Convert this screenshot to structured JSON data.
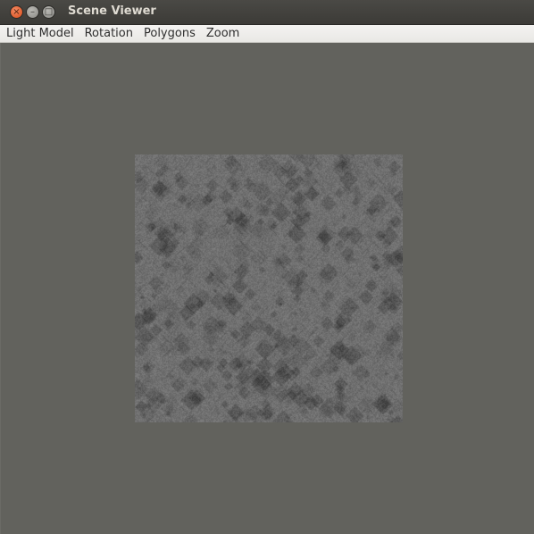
{
  "window": {
    "title": "Scene Viewer"
  },
  "titlebar_buttons": [
    {
      "name": "close-icon",
      "glyph": "×"
    },
    {
      "name": "minimize-icon",
      "glyph": "–"
    },
    {
      "name": "maximize-icon",
      "glyph": "□"
    }
  ],
  "menu": {
    "items": [
      {
        "label": "Light Model"
      },
      {
        "label": "Rotation"
      },
      {
        "label": "Polygons"
      },
      {
        "label": "Zoom"
      }
    ]
  },
  "scene": {
    "background_color": "#62625d",
    "texture_base_color": "#707070",
    "texture_dark_color": "#1c1c1c"
  }
}
